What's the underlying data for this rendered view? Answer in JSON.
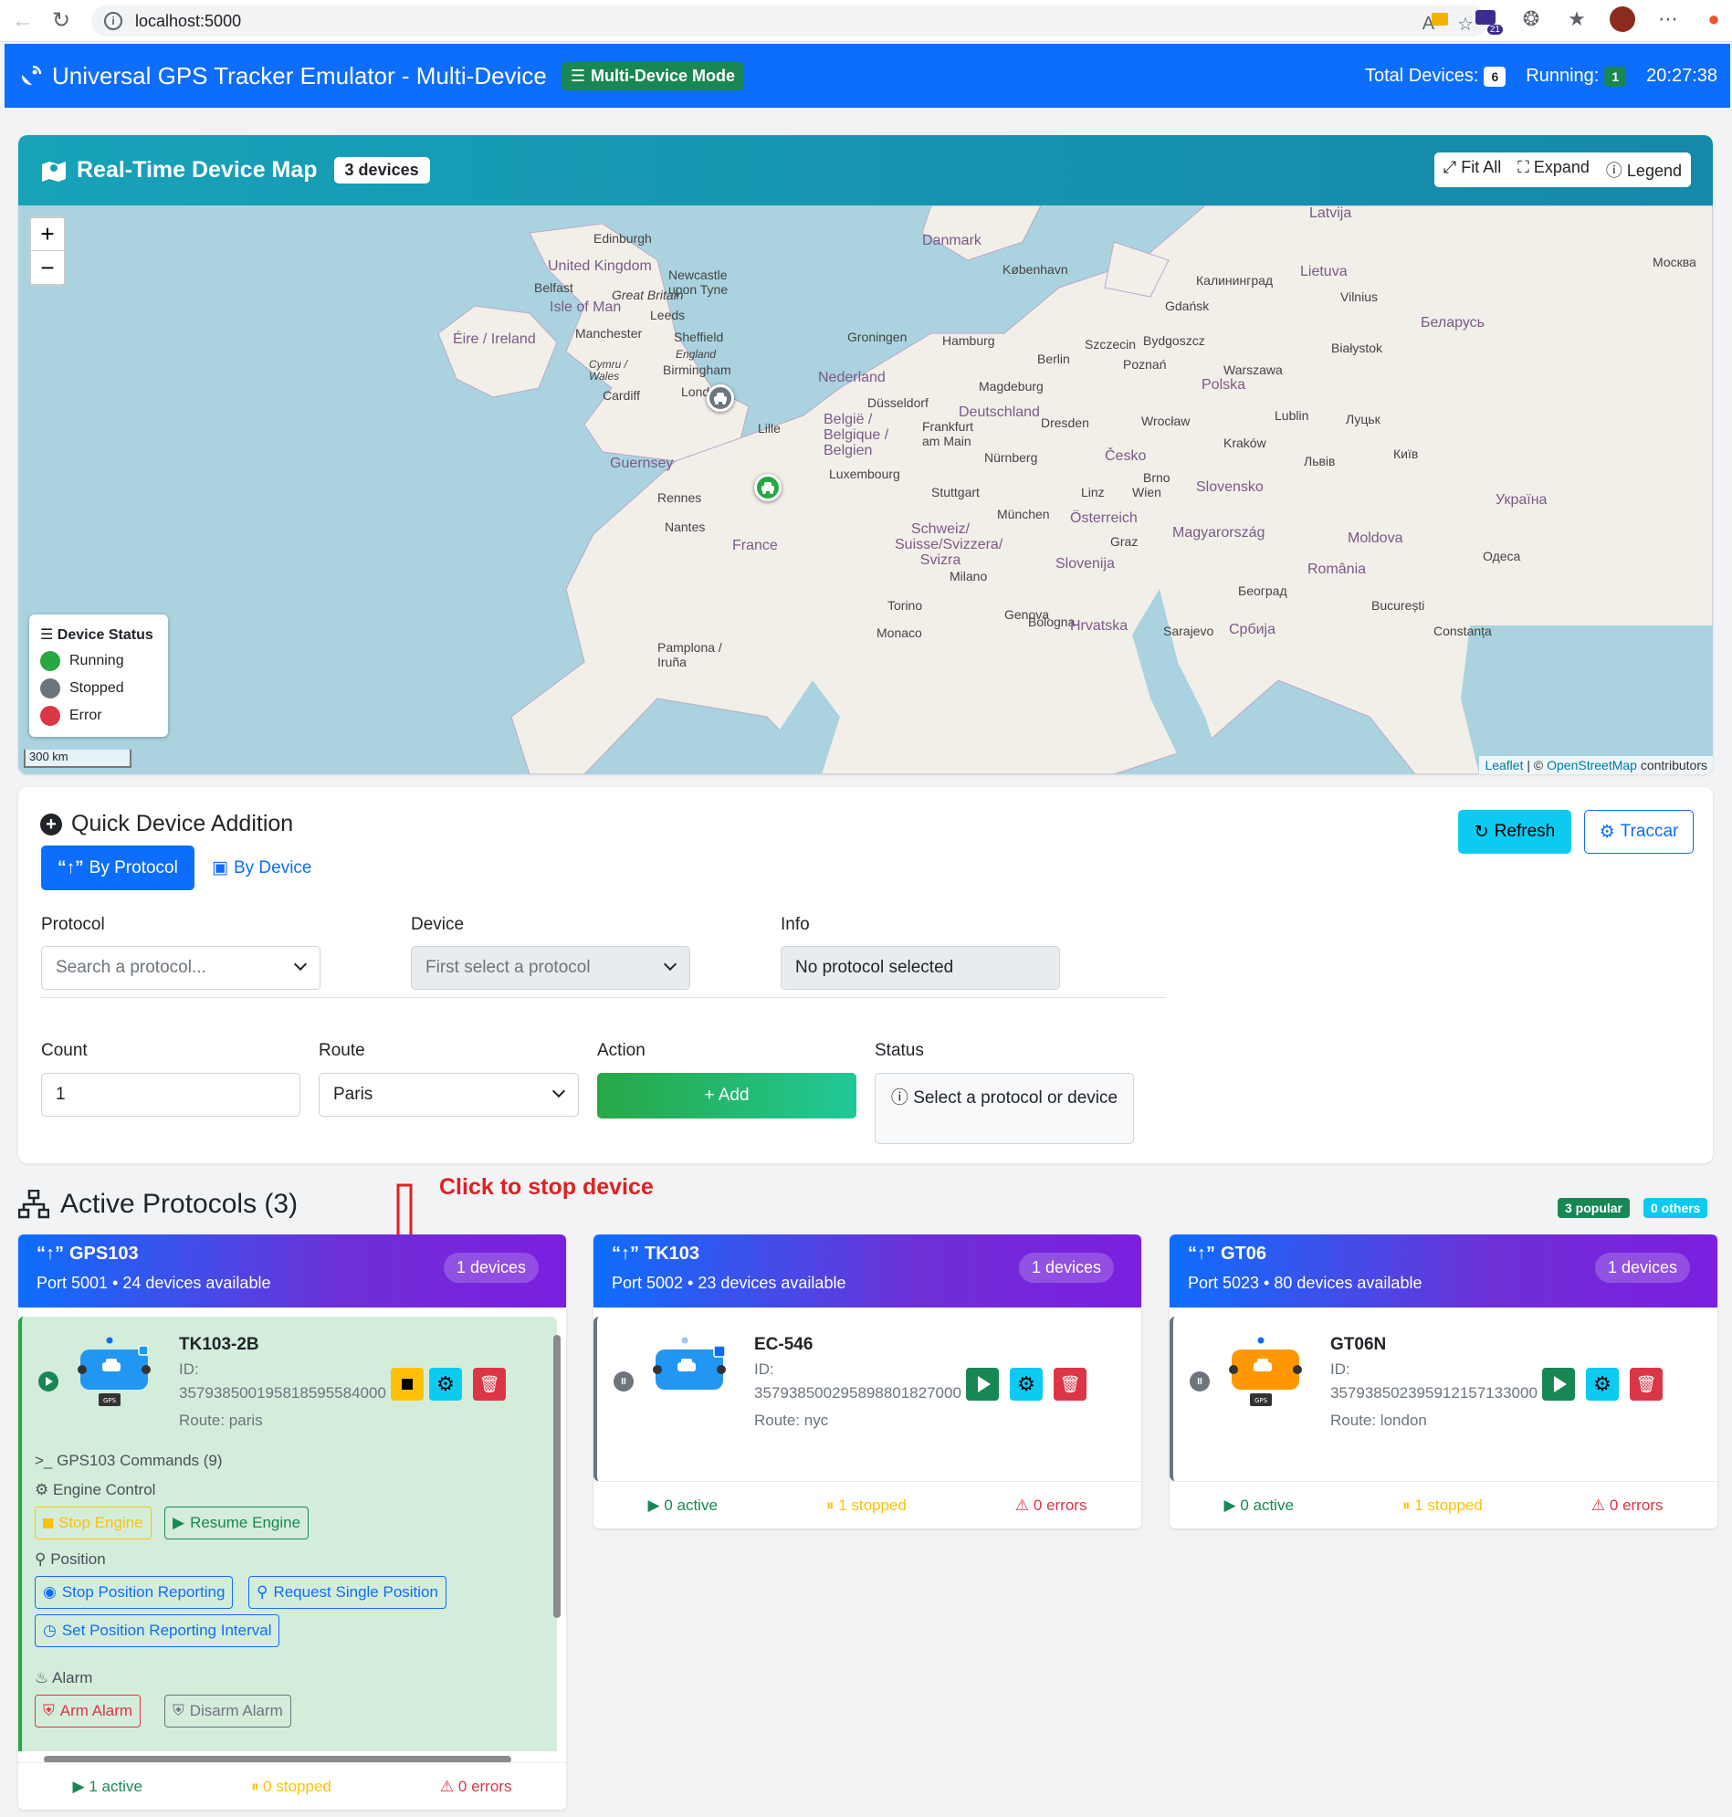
{
  "browser": {
    "url": "localhost:5000"
  },
  "navbar": {
    "title": "Universal GPS Tracker Emulator - Multi-Device",
    "mode_badge": "Multi-Device Mode",
    "total_label": "Total Devices:",
    "total_value": "6",
    "running_label": "Running:",
    "running_value": "1",
    "clock": "20:27:38"
  },
  "map": {
    "title": "Real-Time Device Map",
    "device_count": "3 devices",
    "fit_all": "Fit All",
    "expand": "Expand",
    "legend_btn": "Legend",
    "zoom_in": "+",
    "zoom_out": "−",
    "scale": "300 km",
    "attribution_leaflet": "Leaflet",
    "attribution_osm": "OpenStreetMap",
    "attribution_suffix": "contributors",
    "legend": {
      "title": "Device Status",
      "items": [
        {
          "label": "Running",
          "color": "#28a745"
        },
        {
          "label": "Stopped",
          "color": "#6c757d"
        },
        {
          "label": "Error",
          "color": "#dc3545"
        }
      ]
    },
    "labels": {
      "edinburgh": "Edinburgh",
      "uk": "United Kingdom",
      "newcastle": "Newcastle upon Tyne",
      "belfast": "Belfast",
      "great_britain": "Great Britain",
      "isle_of_man": "Isle of Man",
      "leeds": "Leeds",
      "eire": "Éire / Ireland",
      "manchester": "Manchester",
      "sheffield": "Sheffield",
      "england": "England",
      "cymru": "Cymru / Wales",
      "birmingham": "Birmingham",
      "cardiff": "Cardiff",
      "london": "London",
      "danmark": "Danmark",
      "kobenhavn": "København",
      "groningen": "Groningen",
      "hamburg": "Hamburg",
      "nederland": "Nederland",
      "berlin": "Berlin",
      "dusseldorf": "Düsseldorf",
      "deutschland": "Deutschland",
      "belgie": "België / Belgique / Belgien",
      "lille": "Lille",
      "frankfurt": "Frankfurt am Main",
      "guernsey": "Guernsey",
      "luxembourg": "Luxembourg",
      "nurnberg": "Nürnberg",
      "rennes": "Rennes",
      "nantes": "Nantes",
      "france": "France",
      "stuttgart": "Stuttgart",
      "munchen": "München",
      "schweiz": "Schweiz/ Suisse/Svizzera/ Svizra",
      "milano": "Milano",
      "torino": "Torino",
      "monaco": "Monaco",
      "genova": "Genova",
      "bologna": "Bologna",
      "pamplona": "Pamplona / Iruña",
      "osterreich": "Österreich",
      "wien": "Wien",
      "cesko": "Česko",
      "polska": "Polska",
      "warszawa": "Warszawa",
      "gdansk": "Gdańsk",
      "kaliningrad": "Калининград",
      "lietuva": "Lietuva",
      "latvija": "Latvija",
      "vilnius": "Vilnius",
      "belarus": "Беларусь",
      "moskva": "Москва",
      "kiev": "Київ",
      "ukraina": "Україна",
      "slovensko": "Slovensko",
      "magyarorszag": "Magyarország",
      "romania": "România",
      "moldova": "Moldova",
      "hrvatska": "Hrvatska",
      "srbija": "Србија",
      "bucuresti": "București",
      "odesa": "Одеса",
      "sarajevo": "Sarajevo",
      "beograd": "Београд",
      "slovenija": "Slovenija",
      "constanta": "Constanța",
      "szczecin": "Szczecin",
      "poznan": "Poznań",
      "bydgoszcz": "Bydgoszcz",
      "wroclaw": "Wrocław",
      "krakow": "Kraków",
      "lublin": "Lublin",
      "bialystok": "Białystok",
      "lviv": "Львів",
      "brno": "Brno",
      "linz": "Linz",
      "graz": "Graz",
      "dresden": "Dresden",
      "magdeburg": "Magdeburg"
    }
  },
  "quick_add": {
    "title": "Quick Device Addition",
    "tab_protocol": "By Protocol",
    "tab_device": "By Device",
    "refresh": "Refresh",
    "traccar": "Traccar",
    "protocol_label": "Protocol",
    "protocol_placeholder": "Search a protocol...",
    "device_label": "Device",
    "device_placeholder": "First select a protocol",
    "info_label": "Info",
    "info_value": "No protocol selected",
    "count_label": "Count",
    "count_value": "1",
    "route_label": "Route",
    "route_value": "Paris",
    "action_label": "Action",
    "add_button": "+ Add",
    "status_label": "Status",
    "status_value": "Select a protocol or device"
  },
  "active_protocols": {
    "title": "Active Protocols (3)",
    "annotation": "Click to stop device",
    "popular": "3 popular",
    "others": "0 others",
    "cards": [
      {
        "name": "GPS103",
        "subtitle": "Port 5001 • 24 devices available",
        "badge": "1 devices",
        "device": {
          "name": "TK103-2B",
          "id_label": "ID:",
          "id": "357938500195818595584000",
          "route": "Route: paris"
        },
        "commands_title": "GPS103 Commands (9)",
        "engine_title": "Engine Control",
        "stop_engine": "Stop Engine",
        "resume_engine": "Resume Engine",
        "position_title": "Position",
        "stop_reporting": "Stop Position Reporting",
        "request_single": "Request Single Position",
        "set_interval": "Set Position Reporting Interval",
        "alarm_title": "Alarm",
        "arm_alarm": "Arm Alarm",
        "disarm_alarm": "Disarm Alarm",
        "footer_active": "1 active",
        "footer_stopped": "0 stopped",
        "footer_errors": "0 errors"
      },
      {
        "name": "TK103",
        "subtitle": "Port 5002 • 23 devices available",
        "badge": "1 devices",
        "device": {
          "name": "EC-546",
          "id_label": "ID:",
          "id": "357938500295898801827000",
          "route": "Route: nyc"
        },
        "footer_active": "0 active",
        "footer_stopped": "1 stopped",
        "footer_errors": "0 errors"
      },
      {
        "name": "GT06",
        "subtitle": "Port 5023 • 80 devices available",
        "badge": "1 devices",
        "device": {
          "name": "GT06N",
          "id_label": "ID:",
          "id": "357938502395912157133000",
          "route": "Route: london"
        },
        "footer_active": "0 active",
        "footer_stopped": "1 stopped",
        "footer_errors": "0 errors"
      }
    ]
  }
}
